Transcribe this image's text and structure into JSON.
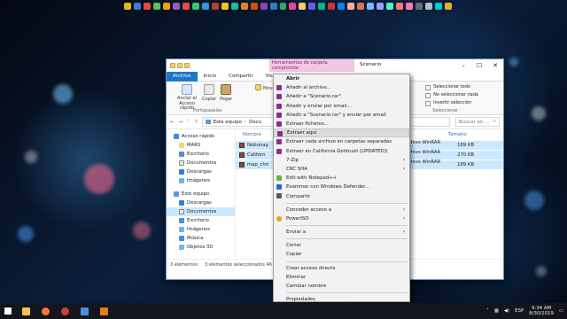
{
  "explorer": {
    "context_tab": "Herramientas de carpeta comprimida",
    "window_title": "Scenario",
    "tabs": [
      "Archivo",
      "Inicio",
      "Compartir",
      "Vista"
    ],
    "ribbon": {
      "anclar": "Anclar al Acceso rápido",
      "copiar": "Copiar",
      "pegar": "Pegar",
      "mover": "Mover",
      "group_portapapeles": "Portapapeles",
      "seleccionar_todo": "Seleccionar todo",
      "no_seleccionar_nada": "No seleccionar nada",
      "invertir_seleccion": "Invertir selección",
      "group_seleccionar": "Seleccionar"
    },
    "address": "Este equipo",
    "address_part2": "Docu",
    "search_placeholder": "Buscar en ...",
    "nav": [
      "Acceso rápido",
      "MARS",
      "Escritorio",
      "Documentos",
      "Descargas",
      "Imágenes",
      "Este equipo",
      "Descargas",
      "Documentos",
      "Escritorio",
      "Imágenes",
      "Música",
      "Objetos 3D"
    ],
    "columns": {
      "name": "Nombre",
      "size": "Tamaño"
    },
    "files": [
      {
        "name": "Nobunag",
        "type": "Archivo WinRAR ZIP",
        "size": "189 KB"
      },
      {
        "name": "Californ",
        "type": "Archivo WinRAR ZIP",
        "size": "270 KB"
      },
      {
        "name": "map_chri",
        "type": "Archivo WinRAR ZIP",
        "size": "189 KB"
      }
    ],
    "status": {
      "count": "3 elementos",
      "selected": "3 elementos seleccionados  46"
    }
  },
  "context_menu": {
    "items": [
      "Abrir",
      "Añadir al archivo...",
      "Añadir a \"Scenario.rar\"",
      "Añadir y enviar por email...",
      "Añadir a \"Scenario.rar\" y enviar por email",
      "Extraer ficheros...",
      "Extraer aquí",
      "Extraer cada archivo en carpetas separadas",
      "Extraer en California Goldrush [UPDATED]\\",
      "7-Zip",
      "CRC SHA",
      "Edit with Notepad++",
      "Examinar con Windows Defender...",
      "Compartir",
      "Conceder acceso a",
      "PowerISO",
      "Enviar a",
      "Cortar",
      "Copiar",
      "Crear acceso directo",
      "Eliminar",
      "Cambiar nombre",
      "Propiedades"
    ]
  },
  "taskbar": {
    "lang": "ESP",
    "time": "9:34 AM",
    "date": "8/30/2019"
  },
  "colors": {
    "accent": "#1979ca",
    "selection": "#cce8ff",
    "context_tab": "#f3c6e3"
  }
}
